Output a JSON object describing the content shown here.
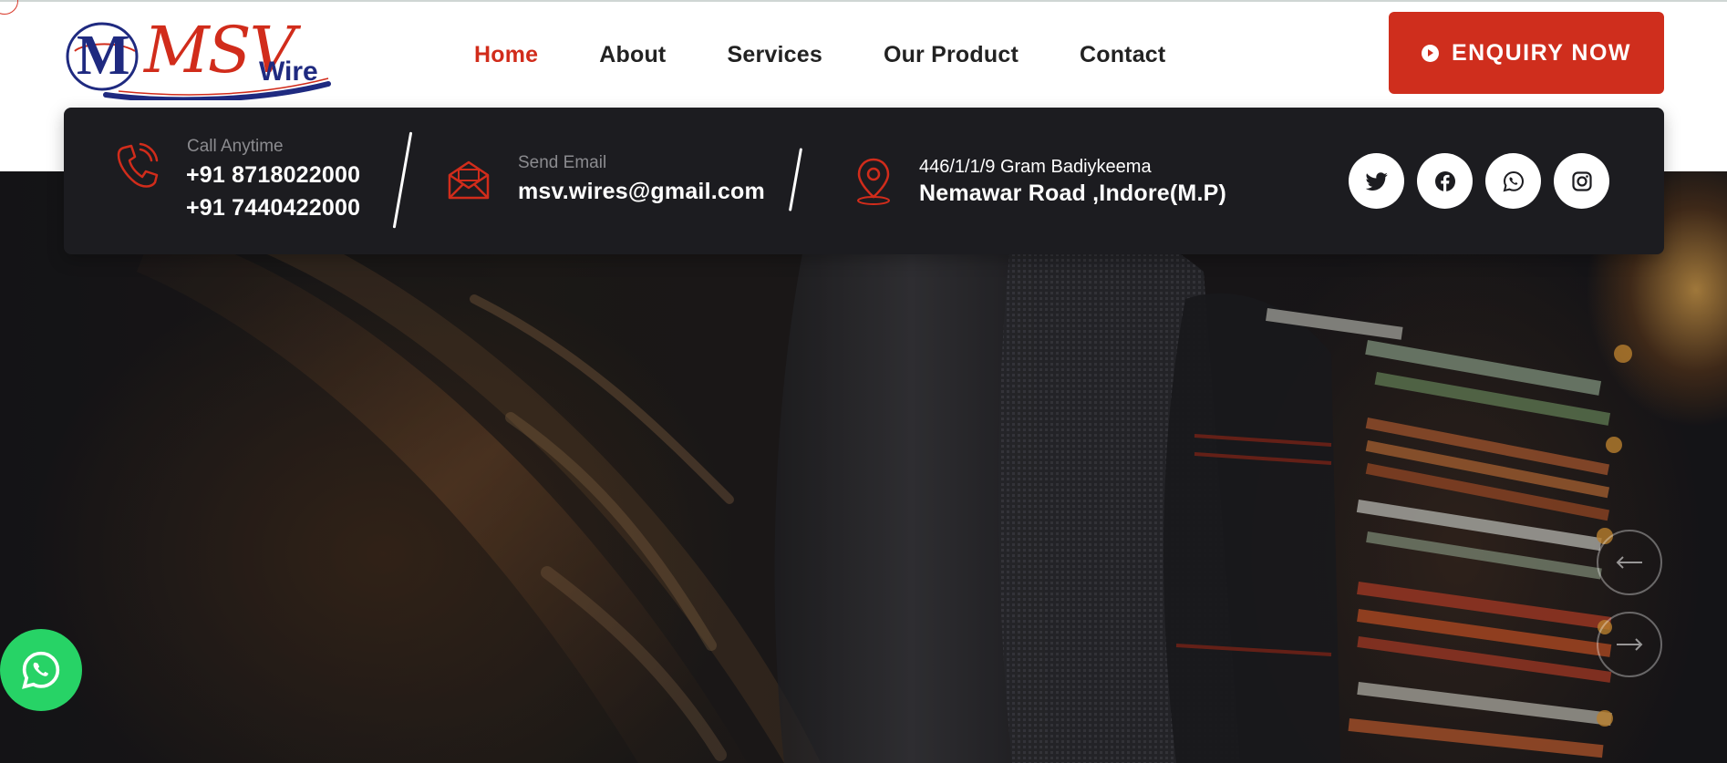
{
  "brand": {
    "logo_letter": "M",
    "logo_main": "MSV",
    "logo_sub": "Wire"
  },
  "nav": {
    "items": [
      {
        "label": "Home",
        "active": true
      },
      {
        "label": "About",
        "active": false
      },
      {
        "label": "Services",
        "active": false
      },
      {
        "label": "Our Product",
        "active": false
      },
      {
        "label": "Contact",
        "active": false
      }
    ]
  },
  "enquiry_button": {
    "label": "ENQUIRY NOW",
    "icon": "arrow-circle-right-icon"
  },
  "info": {
    "call": {
      "label": "Call Anytime",
      "phone1": "+91 8718022000",
      "phone2": "+91 7440422000",
      "icon": "phone-icon"
    },
    "email": {
      "label": "Send Email",
      "value": "msv.wires@gmail.com",
      "icon": "envelope-icon"
    },
    "address": {
      "line1": "446/1/1/9 Gram Badiykeema",
      "line2": "Nemawar Road ,Indore(M.P)",
      "icon": "map-pin-icon"
    }
  },
  "social": [
    "twitter-icon",
    "facebook-icon",
    "whatsapp-icon",
    "instagram-icon"
  ],
  "slider": {
    "prev_icon": "arrow-left-icon",
    "next_icon": "arrow-right-icon"
  },
  "floating": {
    "icon": "whatsapp-icon"
  },
  "colors": {
    "accent": "#cf2e1d",
    "bar": "#1c1c20",
    "whatsapp": "#27d366",
    "logo_blue": "#1f2a80"
  }
}
